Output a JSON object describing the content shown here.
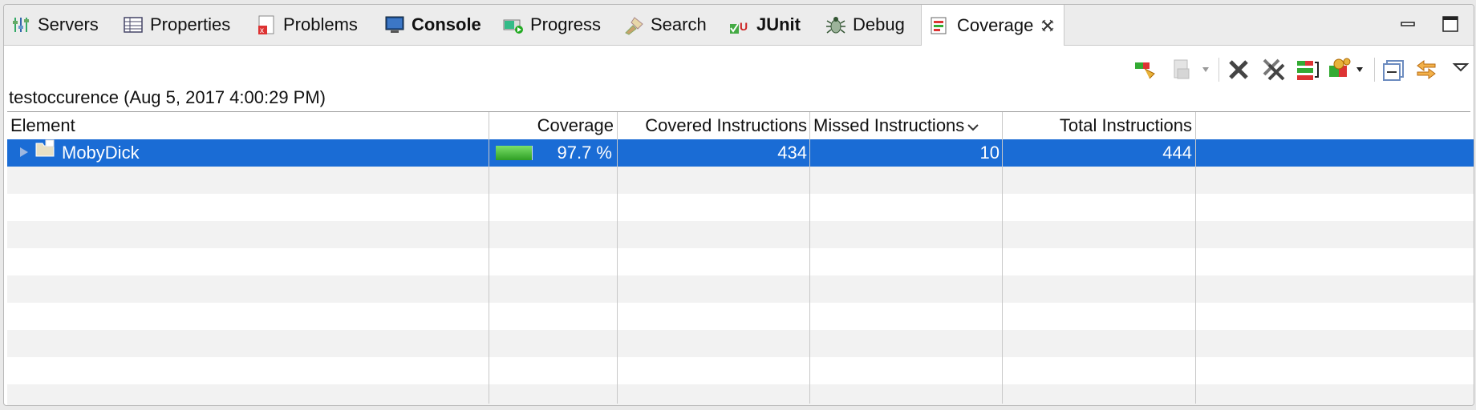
{
  "tabs": [
    {
      "label": "Servers",
      "icon": "servers-icon",
      "bold": false
    },
    {
      "label": "Properties",
      "icon": "properties-icon",
      "bold": false
    },
    {
      "label": "Problems",
      "icon": "problems-icon",
      "bold": false
    },
    {
      "label": "Console",
      "icon": "console-icon",
      "bold": true
    },
    {
      "label": "Progress",
      "icon": "progress-icon",
      "bold": false
    },
    {
      "label": "Search",
      "icon": "search-icon",
      "bold": false
    },
    {
      "label": "JUnit",
      "icon": "junit-icon",
      "bold": true
    },
    {
      "label": "Debug",
      "icon": "debug-icon",
      "bold": false
    },
    {
      "label": "Coverage",
      "icon": "coverage-icon",
      "bold": false,
      "active": true
    }
  ],
  "session_title": "testoccurence (Aug 5, 2017 4:00:29 PM)",
  "columns": {
    "element": "Element",
    "coverage": "Coverage",
    "covered": "Covered Instructions",
    "missed": "Missed Instructions",
    "total": "Total Instructions"
  },
  "rows": [
    {
      "name": "MobyDick",
      "coverage": "97.7 %",
      "coverage_fraction": 0.977,
      "covered": "434",
      "missed": "10",
      "total": "444"
    }
  ],
  "colors": {
    "selection": "#1a6cd5",
    "coverage_bar": "#3fbf2e"
  }
}
